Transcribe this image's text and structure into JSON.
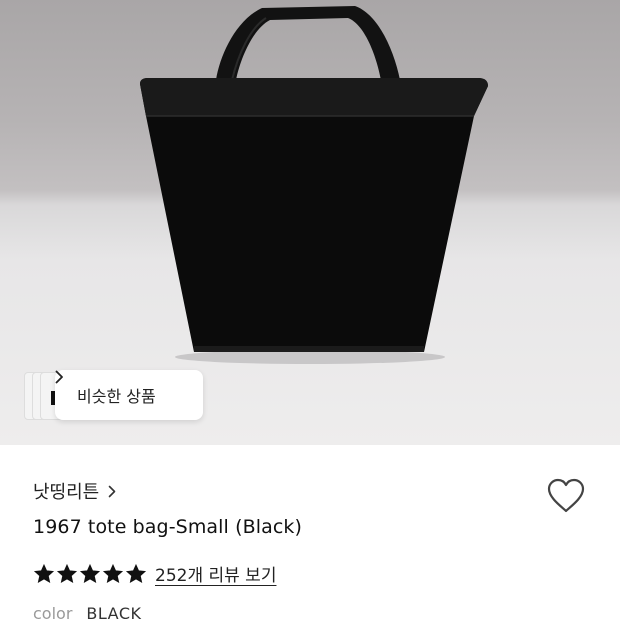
{
  "similar_products": {
    "label": "비슷한 상품"
  },
  "product": {
    "brand": "낫띵리튼",
    "title": "1967 tote bag-Small (Black)",
    "rating": {
      "stars_filled": 5,
      "stars_total": 5
    },
    "review_link": "252개 리뷰 보기",
    "option": {
      "label": "color",
      "value": "BLACK"
    }
  },
  "icons": {
    "similar_chevron": "chevron-right-icon",
    "brand_chevron": "chevron-right-icon",
    "wishlist": "heart-outline-icon",
    "star": "star-filled-icon"
  },
  "colors": {
    "star": "#111111",
    "bag": "#0b0b0b",
    "muted_text": "#9a9a9a"
  }
}
